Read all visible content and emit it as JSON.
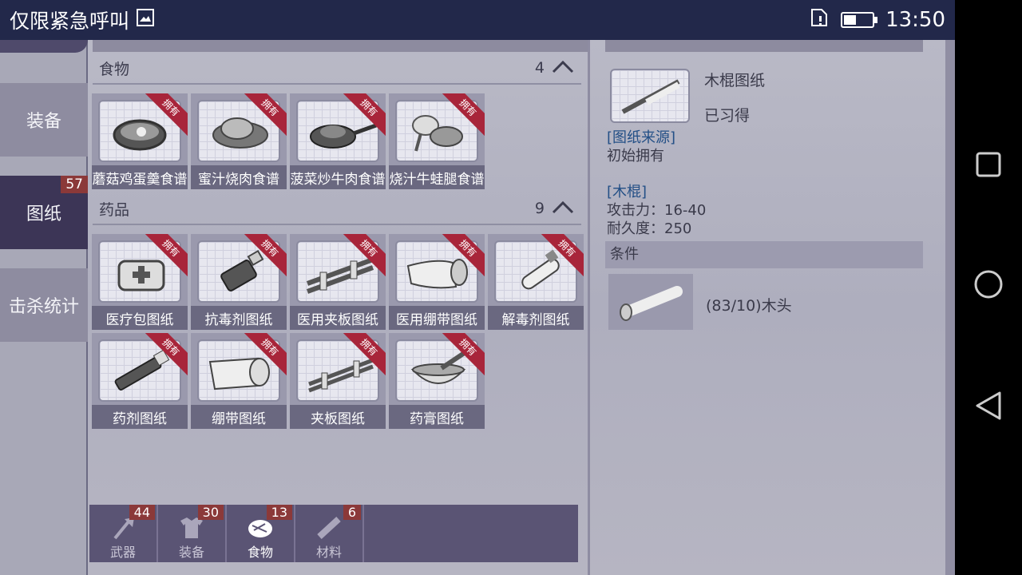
{
  "status": {
    "carrier": "仅限紧急呼叫",
    "time": "13:50"
  },
  "sidebar": {
    "tabs": [
      {
        "label": "装备"
      },
      {
        "label": "图纸",
        "count": "57"
      },
      {
        "label": "击杀统计"
      }
    ]
  },
  "food": {
    "title": "食物",
    "count": "4",
    "items": [
      {
        "label": "蘑菇鸡蛋羹食谱",
        "badge": "拥有"
      },
      {
        "label": "蜜汁烧肉食谱",
        "badge": "拥有"
      },
      {
        "label": "菠菜炒牛肉食谱",
        "badge": "拥有"
      },
      {
        "label": "烧汁牛蛙腿食谱",
        "badge": "拥有"
      }
    ]
  },
  "medicine": {
    "title": "药品",
    "count": "9",
    "items": [
      {
        "label": "医疗包图纸",
        "badge": "拥有"
      },
      {
        "label": "抗毒剂图纸",
        "badge": "拥有"
      },
      {
        "label": "医用夹板图纸",
        "badge": "拥有"
      },
      {
        "label": "医用绷带图纸",
        "badge": "拥有"
      },
      {
        "label": "解毒剂图纸",
        "badge": "拥有"
      },
      {
        "label": "药剂图纸",
        "badge": "拥有"
      },
      {
        "label": "绷带图纸",
        "badge": "拥有"
      },
      {
        "label": "夹板图纸",
        "badge": "拥有"
      },
      {
        "label": "药膏图纸",
        "badge": "拥有"
      }
    ]
  },
  "bottom_tabs": [
    {
      "label": "武器",
      "count": "44"
    },
    {
      "label": "装备",
      "count": "30"
    },
    {
      "label": "食物",
      "count": "13"
    },
    {
      "label": "材料",
      "count": "6"
    }
  ],
  "detail": {
    "name": "木棍图纸",
    "state": "已习得",
    "source_title": "[图纸来源]",
    "source_value": "初始拥有",
    "weapon_title": "[木棍]",
    "attack": "攻击力：16-40",
    "durability": "耐久度：250",
    "condition_header": "条件",
    "condition_text": "(83/10)木头"
  },
  "colors": {
    "badge_red": "#a8253a",
    "tab_active": "#3c3556",
    "link_blue": "#234f86"
  }
}
